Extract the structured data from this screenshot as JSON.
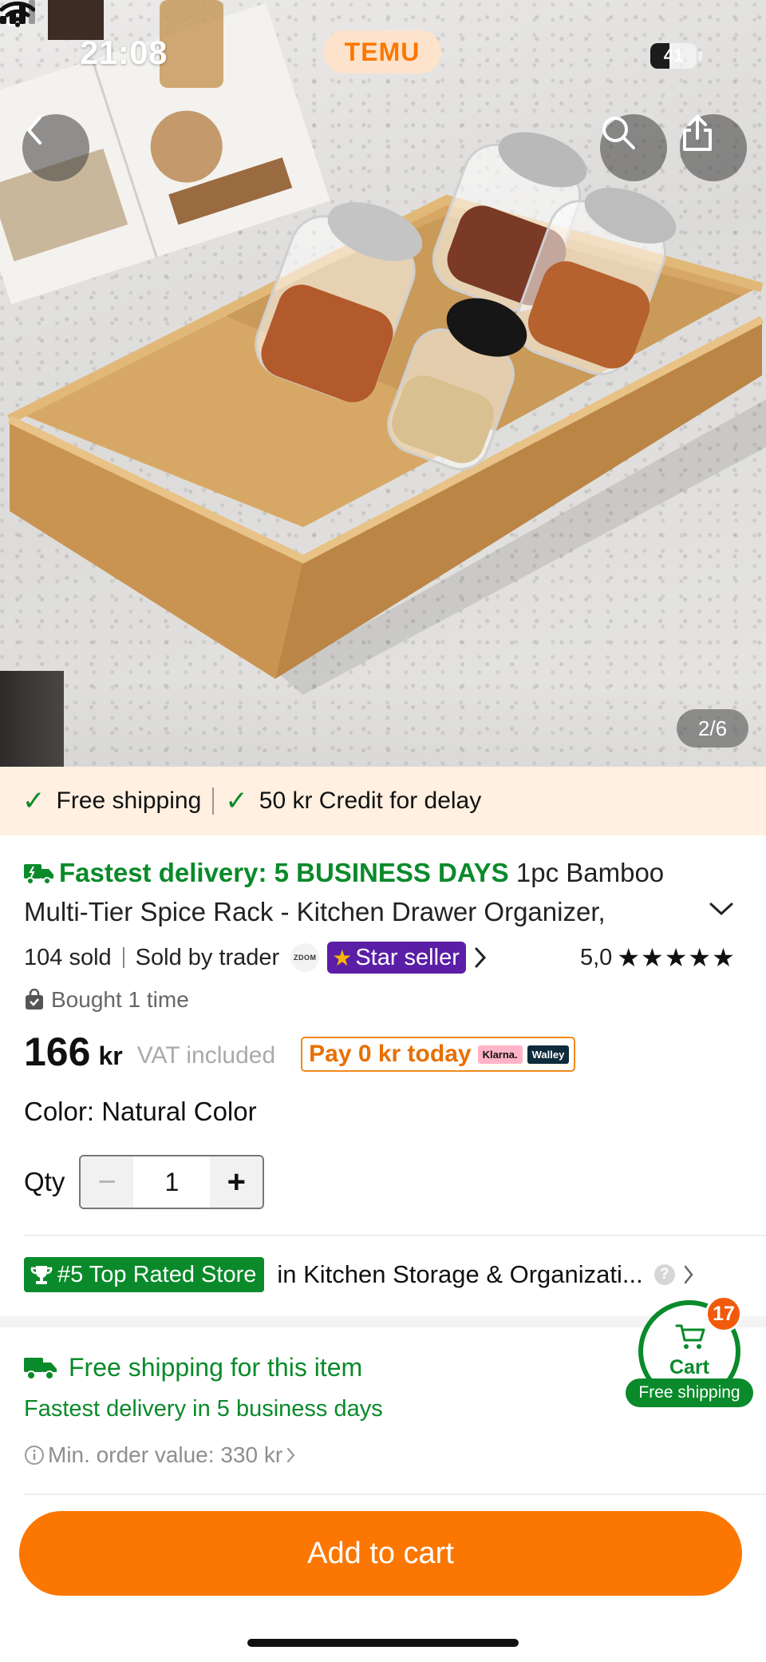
{
  "status_bar": {
    "time": "21:08",
    "battery": "41",
    "battery_level": 0.41
  },
  "header": {
    "brand": "TEMU"
  },
  "gallery": {
    "counter": "2/6"
  },
  "shipping_banner": {
    "item1": "Free shipping",
    "item2": "50 kr Credit for delay"
  },
  "product": {
    "delivery_label": "Fastest delivery: 5 BUSINESS DAYS",
    "title_line1": "1pc Bamboo",
    "title_line2": "Multi-Tier Spice Rack - Kitchen Drawer Organizer,",
    "sold": "104 sold",
    "sold_by": "Sold by trader",
    "seller_logo": "ZDOM",
    "seller_badge": "Star seller",
    "rating_value": "5,0",
    "rating_stars": "★★★★★",
    "bought": "Bought 1 time",
    "price": "166",
    "currency": "kr",
    "vat": "VAT included",
    "pay_today": "Pay 0 kr today",
    "klarna": "Klarna.",
    "walley": "Walley",
    "color_line": "Color: Natural Color",
    "qty_label": "Qty",
    "qty_value": "1",
    "qty_minus": "−",
    "qty_plus": "+"
  },
  "ranking": {
    "badge": "#5 Top Rated Store",
    "category": "in Kitchen Storage & Organizati...",
    "help": "?"
  },
  "shipping_info": {
    "title": "Free shipping for this item",
    "fastest": "Fastest delivery in 5 business days",
    "min_order": "Min. order value: 330 kr"
  },
  "cart_float": {
    "label": "Cart",
    "count": "17",
    "free": "Free shipping"
  },
  "cta": {
    "add_to_cart": "Add to cart"
  },
  "colors": {
    "brand_orange": "#fb7701",
    "green": "#0a8a2a",
    "star_seller_purple": "#5b1ea6",
    "banner_bg": "#fff0e1"
  },
  "icons": [
    "flame-icon",
    "cellular-signal-icon",
    "wifi-icon",
    "battery-icon",
    "back-arrow-icon",
    "search-icon",
    "share-icon",
    "check-icon",
    "truck-icon",
    "chevron-down-icon",
    "chevron-right-icon",
    "star-icon",
    "shopping-bag-icon",
    "trophy-icon",
    "question-icon",
    "info-icon",
    "cart-icon"
  ]
}
